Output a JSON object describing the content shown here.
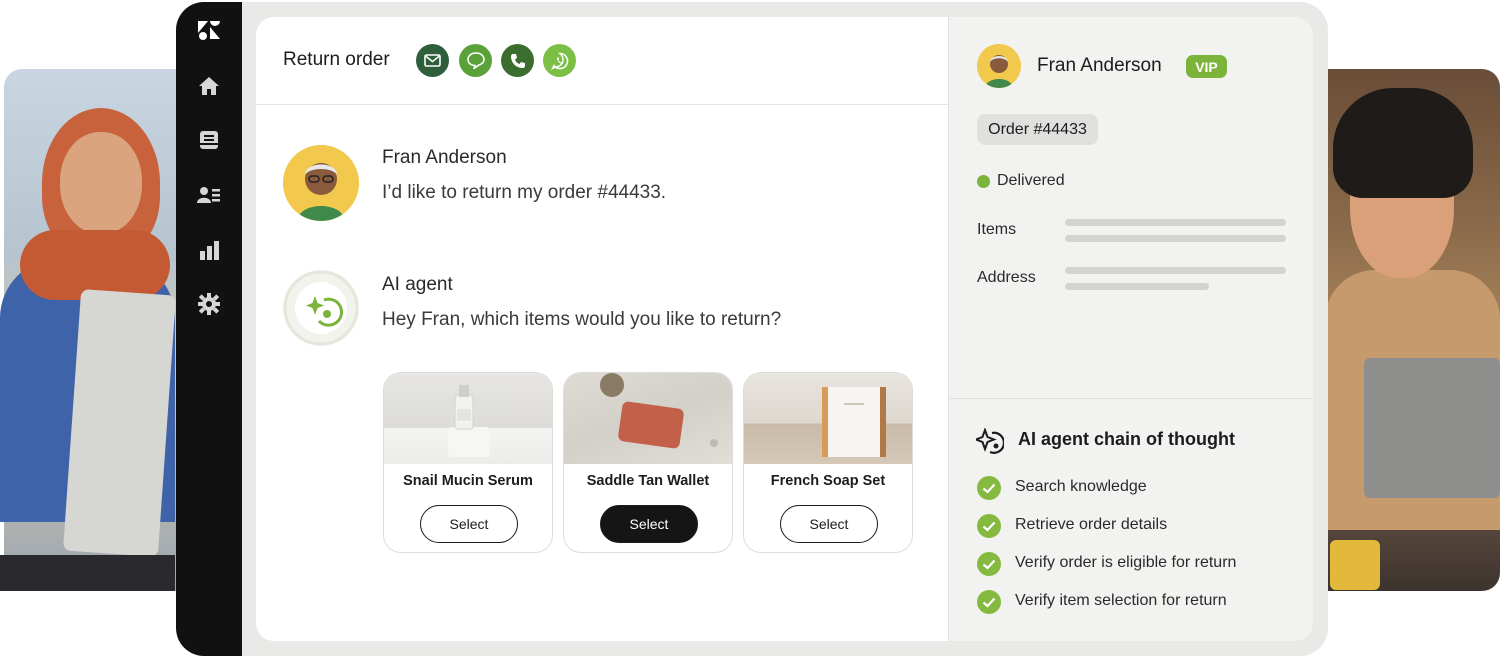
{
  "app": {
    "nav": [
      {
        "icon": "zendesk-logo-icon"
      },
      {
        "icon": "home-icon"
      },
      {
        "icon": "tickets-icon"
      },
      {
        "icon": "contacts-icon"
      },
      {
        "icon": "reporting-icon"
      },
      {
        "icon": "settings-icon"
      }
    ]
  },
  "header": {
    "title": "Return order",
    "channels": [
      {
        "icon": "email-icon",
        "color": "#2f5e3a"
      },
      {
        "icon": "chat-icon",
        "color": "#5aa13a"
      },
      {
        "icon": "phone-icon",
        "color": "#3b6d2f"
      },
      {
        "icon": "whatsapp-icon",
        "color": "#7bbf45"
      }
    ]
  },
  "conversation": {
    "customer": {
      "name": "Fran Anderson",
      "message": "I’d like to return my order #44433."
    },
    "agent": {
      "name": "AI agent",
      "message": "Hey Fran, which items would you like to return?"
    },
    "products": [
      {
        "name": "Snail Mucin Serum",
        "button": "Select",
        "selected": false
      },
      {
        "name": "Saddle Tan Wallet",
        "button": "Select",
        "selected": true
      },
      {
        "name": "French Soap Set",
        "button": "Select",
        "selected": false
      }
    ]
  },
  "sidebar": {
    "customer_name": "Fran Anderson",
    "badge": "VIP",
    "order": "Order #44433",
    "status": "Delivered",
    "status_color": "#7bb33b",
    "items_label": "Items",
    "address_label": "Address",
    "chain_title": "AI agent chain of thought",
    "steps": [
      "Search knowledge",
      "Retrieve order details",
      "Verify order is eligible for return",
      "Verify item selection for return"
    ]
  }
}
